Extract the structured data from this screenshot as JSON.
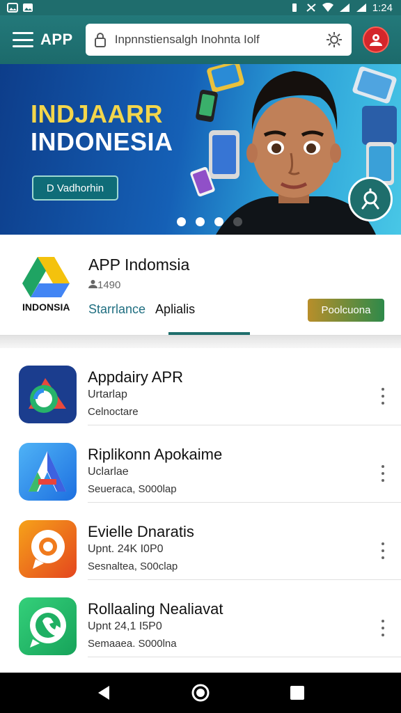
{
  "status_bar": {
    "time": "1:24"
  },
  "app_bar": {
    "brand": "APP",
    "search": {
      "value": "Inpnnstiensalgh Inohnta Iolf",
      "placeholder": ""
    }
  },
  "banner": {
    "title_line1": "INDJAARR",
    "title_line2": "INDONESIA",
    "button_label": "D Vadhorhin",
    "active_slide": 3,
    "slide_count": 4
  },
  "featured_app": {
    "logo_label": "INDONSIA",
    "title": "APP Indomsia",
    "count": "1490",
    "tabs": [
      "Starrlance",
      "Aplialis"
    ],
    "action_label": "Poolcuona"
  },
  "apps": [
    {
      "name": "Appdairy APR",
      "line1": "Urtarlap",
      "line2": "Celnoctare",
      "icon": "app-icon-a-blue-red"
    },
    {
      "name": "Riplikonn Apokaime",
      "line1": "Uclarlae",
      "line2": "Seueraca, S000lap",
      "icon": "app-icon-a-triangle"
    },
    {
      "name": "Evielle Dnaratis",
      "line1": "Upnt. 24K I0P0",
      "line2": "Sesnaltea, S00clap",
      "icon": "app-icon-chat-orange"
    },
    {
      "name": "Rollaaling Nealiavat",
      "line1": "Upnt 24,1 I5P0",
      "line2": "Semaaea. S000lna",
      "icon": "app-icon-chat-green"
    }
  ],
  "colors": {
    "app_bar": "#1f6d6d",
    "accent": "#1e6e6c",
    "banner_title_yellow": "#f3d64b"
  }
}
